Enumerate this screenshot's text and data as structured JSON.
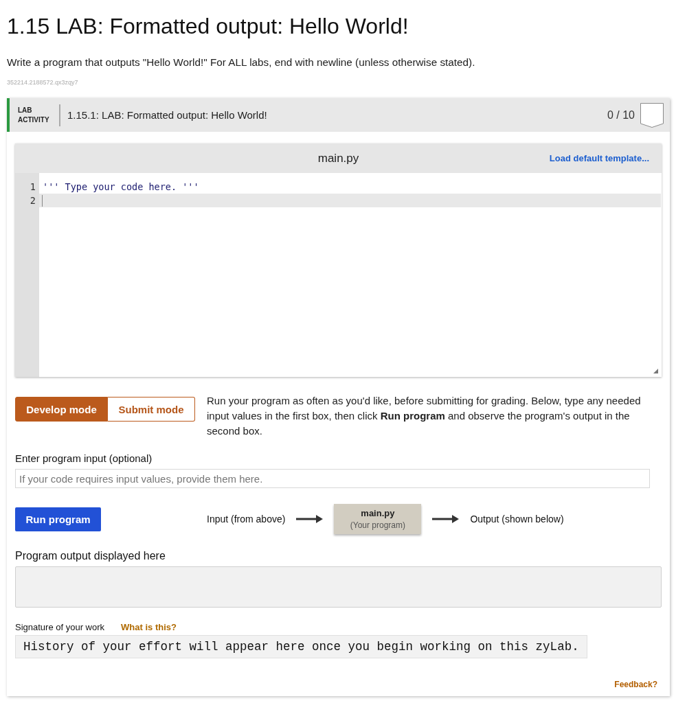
{
  "page": {
    "title": "1.15 LAB: Formatted output: Hello World!",
    "description": "Write a program that outputs \"Hello World!\" For ALL labs, end with newline (unless otherwise stated).",
    "id_text": "352214.2188572.qx3zqy7"
  },
  "activity": {
    "type_label": "LAB ACTIVITY",
    "title": "1.15.1: LAB: Formatted output: Hello World!",
    "score": "0 / 10"
  },
  "editor": {
    "filename": "main.py",
    "load_template_link": "Load default template...",
    "lines": [
      {
        "number": "1",
        "code": "''' Type your code here. '''",
        "active": false
      },
      {
        "number": "2",
        "active": true
      }
    ]
  },
  "modes": [
    {
      "label": "Develop mode",
      "selected": true
    },
    {
      "label": "Submit mode",
      "selected": false
    }
  ],
  "mode_help": "Run your program as often as you'd like, before submitting for grading. Below, type any needed input values in the first box, then click **Run program** and observe the program's output in the second box.",
  "input": {
    "label": "Enter program input (optional)",
    "placeholder": "If your code requires input values, provide them here."
  },
  "run": {
    "button": "Run program",
    "flow": [
      {
        "kind": "text",
        "text": "Input (from above)"
      },
      {
        "kind": "arrow"
      },
      {
        "kind": "box",
        "title": "main.py",
        "subtitle": "(Your program)"
      },
      {
        "kind": "arrow"
      },
      {
        "kind": "text",
        "text": "Output (shown below)"
      }
    ]
  },
  "output": {
    "label": "Program output displayed here"
  },
  "signature": {
    "label": "Signature of your work",
    "help_link": "What is this?",
    "text": "History of your effort will appear here once you begin working on this zyLab."
  },
  "feedback_link": "Feedback?"
}
